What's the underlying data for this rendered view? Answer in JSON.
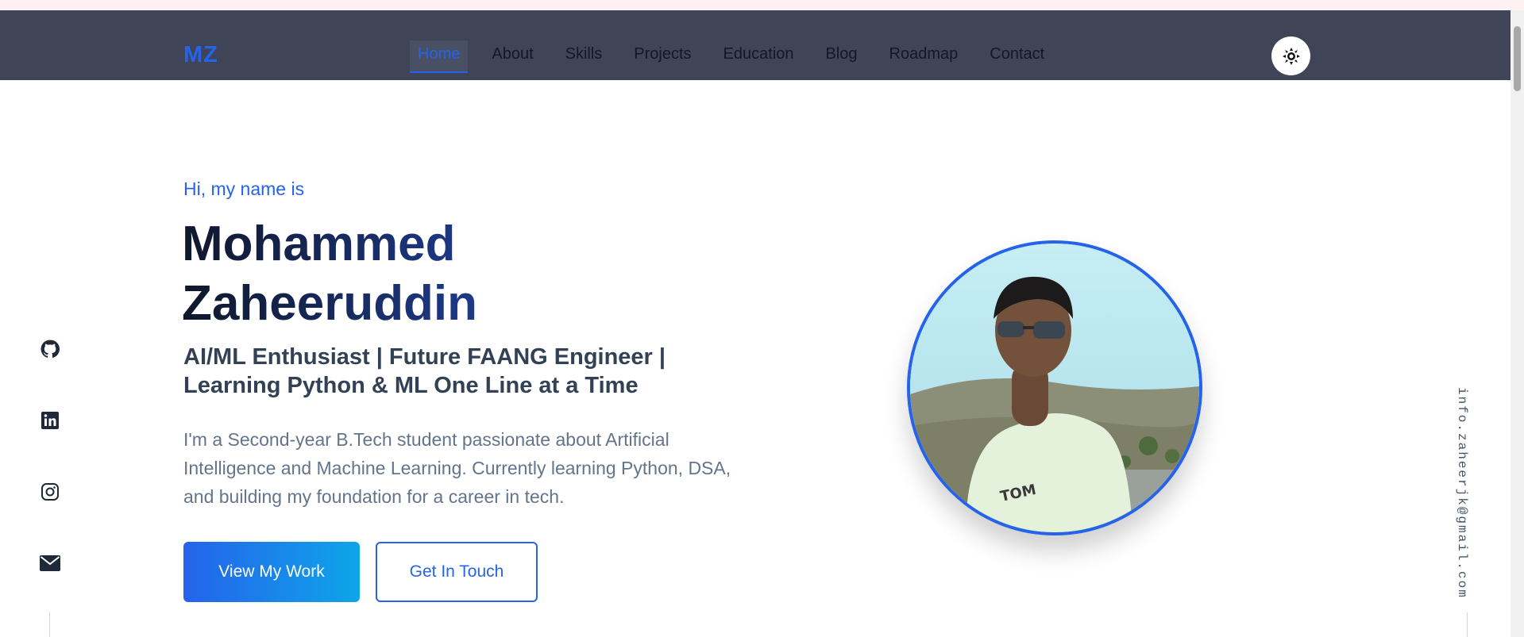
{
  "nav": {
    "logo": "MZ",
    "links": [
      "Home",
      "About",
      "Skills",
      "Projects",
      "Education",
      "Blog",
      "Roadmap",
      "Contact"
    ],
    "active": "Home",
    "theme_toggle_icon": "sun-icon"
  },
  "hero": {
    "greeting": "Hi, my name is",
    "name_line1": "Mohammed",
    "name_line2": "Zaheeruddin",
    "tagline_line1": "AI/ML Enthusiast | Future FAANG Engineer |",
    "tagline_line2": "Learning Python & ML One Line at a Time",
    "bio": "I'm a Second-year B.Tech student passionate about Artificial Intelligence and Machine Learning. Currently learning Python, DSA, and building my foundation for a career in tech.",
    "primary_button": "View My Work",
    "secondary_button": "Get In Touch"
  },
  "social": [
    "github-icon",
    "linkedin-icon",
    "instagram-icon",
    "mail-icon"
  ],
  "email": "info.zaheerjk@gmail.com",
  "colors": {
    "accent": "#2563eb",
    "navbar": "#3f4456",
    "text_dark": "#0f172a",
    "text_muted": "#64748b"
  }
}
